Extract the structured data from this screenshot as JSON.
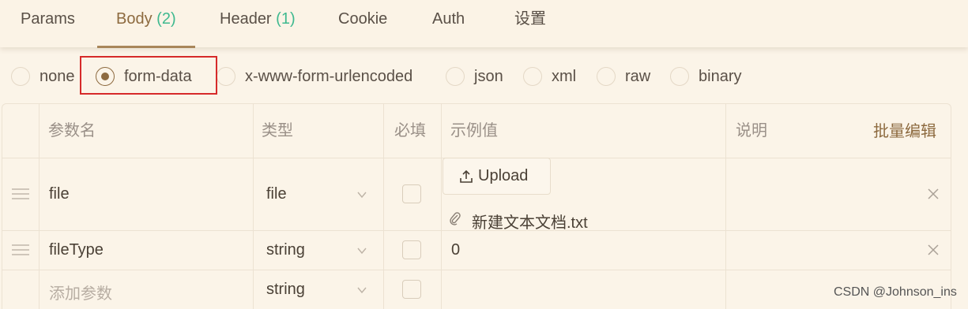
{
  "tabs": [
    {
      "label": "Params",
      "count": ""
    },
    {
      "label": "Body",
      "count": "(2)"
    },
    {
      "label": "Header",
      "count": "(1)"
    },
    {
      "label": "Cookie",
      "count": ""
    },
    {
      "label": "Auth",
      "count": ""
    },
    {
      "label": "设置",
      "count": ""
    }
  ],
  "active_tab": "Body",
  "body_types": [
    "none",
    "form-data",
    "x-www-form-urlencoded",
    "json",
    "xml",
    "raw",
    "binary"
  ],
  "selected_body_type": "form-data",
  "table": {
    "headers": {
      "name": "参数名",
      "type": "类型",
      "required": "必填",
      "example": "示例值",
      "description": "说明"
    },
    "batch_edit": "批量编辑",
    "rows": [
      {
        "name": "file",
        "type": "file",
        "required": false,
        "upload_label": "Upload",
        "attachment": "新建文本文档.txt"
      },
      {
        "name": "fileType",
        "type": "string",
        "required": false,
        "example": "0"
      }
    ],
    "new_row": {
      "placeholder": "添加参数",
      "type": "string",
      "required": false
    }
  },
  "icons": {
    "drag": "drag-handle-icon",
    "chevron": "chevron-down-icon",
    "upload": "upload-icon",
    "paperclip": "paperclip-icon",
    "close": "close-icon"
  },
  "colors": {
    "accent": "#8d6a3f",
    "count": "#3fb98f",
    "highlight": "#d62a2a",
    "background": "#fbf4e8"
  },
  "watermark": "CSDN @Johnson_ins"
}
